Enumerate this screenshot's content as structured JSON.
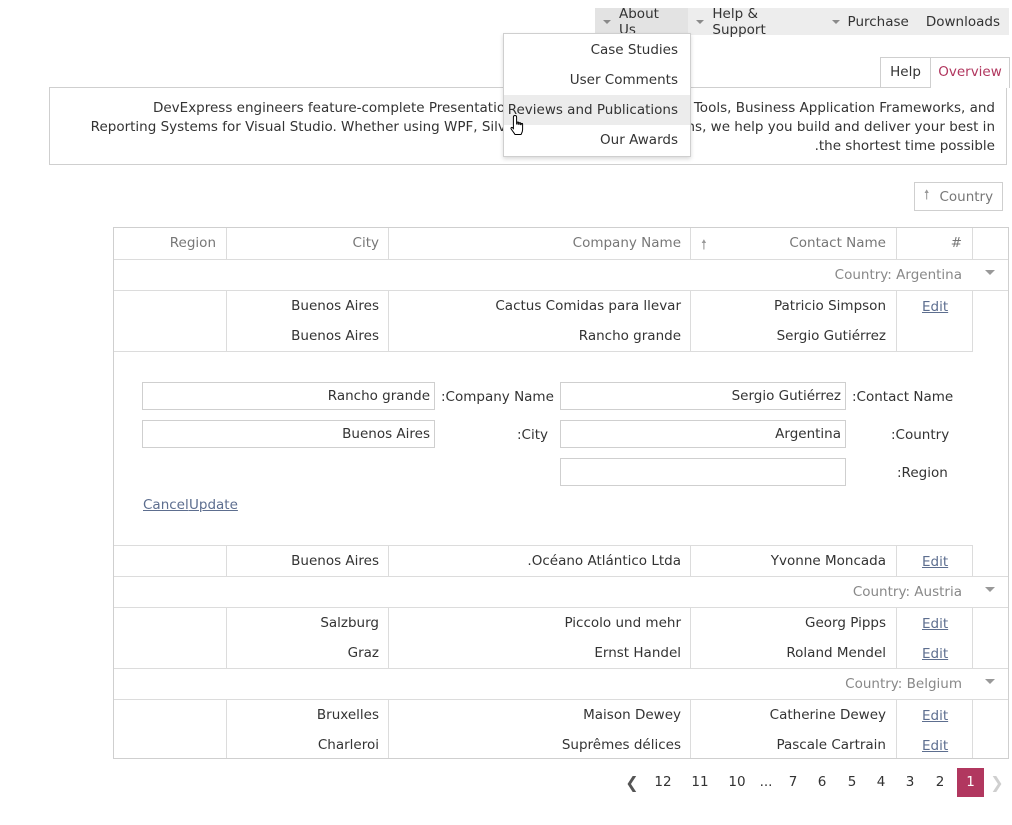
{
  "menu": {
    "items": [
      {
        "label": "About Us",
        "has_caret": true
      },
      {
        "label": "Help & Support",
        "has_caret": true
      },
      {
        "label": "Purchase",
        "has_caret": true
      },
      {
        "label": "Downloads",
        "has_caret": false
      }
    ],
    "dropdown": [
      "Case Studies",
      "User Comments",
      "Reviews and Publications",
      "Our Awards"
    ]
  },
  "tabs": {
    "help": "Help",
    "overview": "Overview"
  },
  "overview_text": "DevExpress engineers feature-complete Presentation Controls, IDE Productivity Tools, Business Application Frameworks, and Reporting Systems for Visual Studio. Whether using WPF, Silverlight, ASP.NET or WinForms, we help you build and deliver your best in the shortest time possible.",
  "group_panel": {
    "chip_label": "Country"
  },
  "grid": {
    "columns": {
      "region": "Region",
      "city": "City",
      "company": "Company Name",
      "contact": "Contact Name",
      "number": "#"
    },
    "groups": [
      {
        "label": "Country: Argentina"
      },
      {
        "label": "Country: Austria"
      },
      {
        "label": "Country: Belgium"
      }
    ],
    "rows": [
      {
        "city": "Buenos Aires",
        "company": "Cactus Comidas para llevar",
        "contact": "Patricio Simpson",
        "edit": "Edit"
      },
      {
        "city": "Buenos Aires",
        "company": "Rancho grande",
        "contact": "Sergio Gutiérrez",
        "edit": ""
      },
      {
        "city": "Buenos Aires",
        "company": ".Océano Atlántico Ltda",
        "contact": "Yvonne Moncada",
        "edit": "Edit"
      },
      {
        "city": "Salzburg",
        "company": "Piccolo und mehr",
        "contact": "Georg Pipps",
        "edit": "Edit"
      },
      {
        "city": "Graz",
        "company": "Ernst Handel",
        "contact": "Roland Mendel",
        "edit": "Edit"
      },
      {
        "city": "Bruxelles",
        "company": "Maison Dewey",
        "contact": "Catherine Dewey",
        "edit": "Edit"
      },
      {
        "city": "Charleroi",
        "company": "Suprêmes délices",
        "contact": "Pascale Cartrain",
        "edit": "Edit"
      }
    ],
    "edit_form": {
      "company_label": ":Company Name",
      "company_value": "Rancho grande",
      "contact_label": ":Contact Name",
      "contact_value": "Sergio Gutiérrez",
      "city_label": ":City",
      "city_value": "Buenos Aires",
      "country_label": ":Country",
      "country_value": "Argentina",
      "region_label": ":Region",
      "region_value": "",
      "cancel": "Cancel",
      "update": "Update"
    }
  },
  "pager": {
    "prev": "❮",
    "pages": [
      "12",
      "11",
      "10",
      "...",
      "7",
      "6",
      "5",
      "4",
      "3",
      "2",
      "1"
    ],
    "current": "1",
    "next": "❯"
  },
  "colors": {
    "accent": "#b1375f",
    "link": "#5d6e8f",
    "border": "#cfcfcf"
  }
}
